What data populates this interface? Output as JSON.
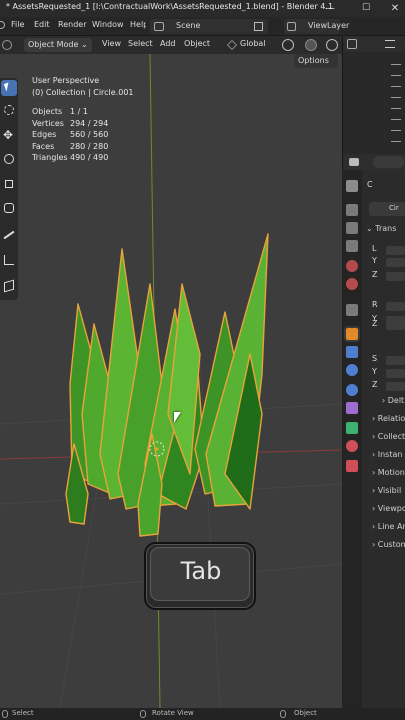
{
  "window": {
    "title": "* AssetsRequested_1 [I:\\ContractualWork\\AssetsRequested_1.blend] - Blender 4.1",
    "minimize": "—",
    "maximize": "☐",
    "close": "✕"
  },
  "menubar": {
    "items": [
      "File",
      "Edit",
      "Render",
      "Window",
      "Help"
    ],
    "scene_label": "Scene",
    "viewlayer_label": "ViewLayer"
  },
  "view_header": {
    "mode": "Object Mode",
    "menus": [
      "View",
      "Select",
      "Add",
      "Object"
    ],
    "orientation": "Global",
    "options": "Options"
  },
  "viewport": {
    "perspective": "User Perspective",
    "collection": "(0) Collection | Circle.001",
    "stats": [
      {
        "label": "Objects",
        "value": "1 / 1"
      },
      {
        "label": "Vertices",
        "value": "294 / 294"
      },
      {
        "label": "Edges",
        "value": "560 / 560"
      },
      {
        "label": "Faces",
        "value": "280 / 280"
      },
      {
        "label": "Triangles",
        "value": "490 / 490"
      }
    ],
    "key_overlay": "Tab",
    "colors": {
      "background": "#3d3d3d",
      "grass_light": "#5bb532",
      "grass_dark": "#1f6d18",
      "selection_outline": "#e8a33a",
      "active_tool": "#4772b3"
    }
  },
  "outliner": {
    "filter_icon": "filter-icon"
  },
  "properties": {
    "object_name": "Cir",
    "header_label": "C",
    "panels": [
      "Trans",
      "Delt",
      "Relatio",
      "Collect",
      "Instan",
      "Motion",
      "Visibil",
      "Viewpo",
      "Line Ar",
      "Custom"
    ],
    "transform_rows": [
      "L",
      "Y",
      "Z",
      "R",
      "Y",
      "Z",
      "S",
      "Y",
      "Z"
    ]
  },
  "statusbar": {
    "select": "Select",
    "rotate": "Rotate View",
    "object": "Object"
  }
}
